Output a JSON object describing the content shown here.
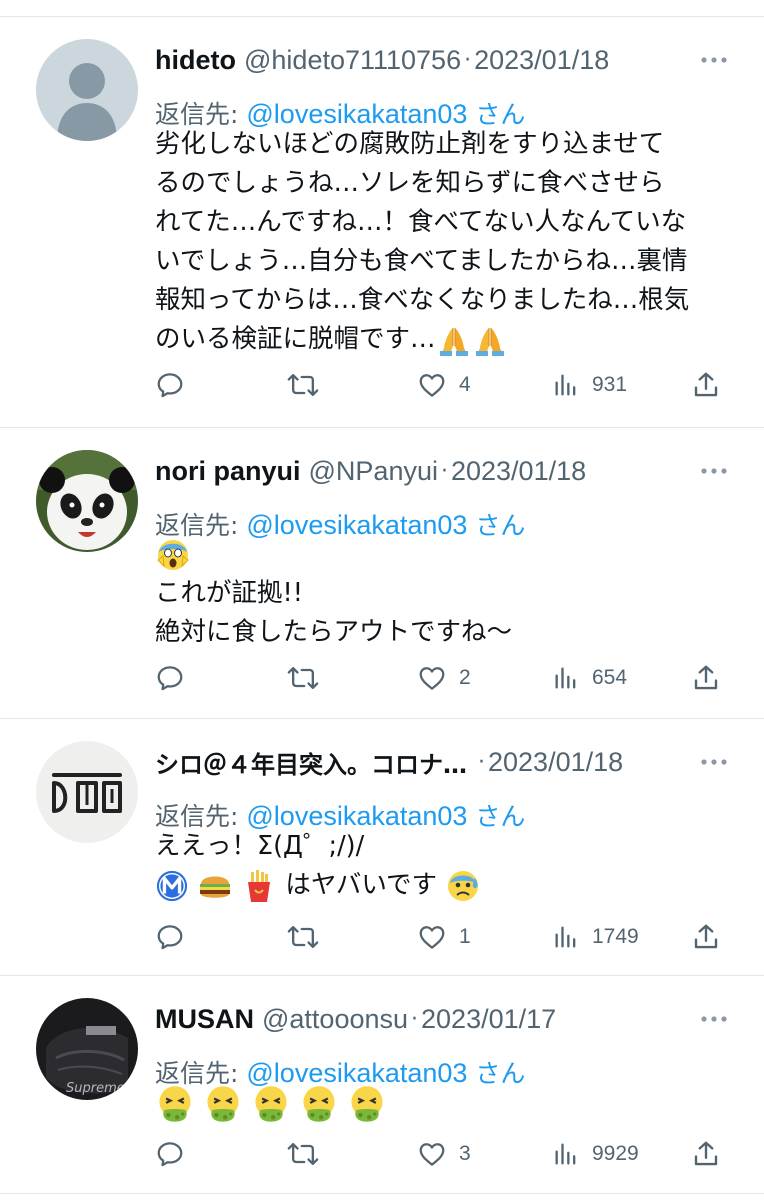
{
  "reply_prefix": "返信先:",
  "reply_suffix": "さん",
  "tweets": [
    {
      "name": "hideto",
      "handle": "@hideto71110756",
      "date": "2023/01/18",
      "reply_to": "@lovesikakatan03",
      "lines": [
        "劣化しないほどの腐敗防止剤をすり込ませて",
        "るのでしょうね…ソレを知らずに食べさせら",
        "れてた…んですね…！食べてない人なんていな",
        "いでしょう…自分も食べてましたからね…裏情",
        "報知ってからは…食べなくなりましたね…根気",
        "のいる検証に脱帽です…"
      ],
      "trailing_emoji": [
        "folded-hands",
        "folded-hands"
      ],
      "likes": "4",
      "views": "931",
      "avatar": "default-silhouette"
    },
    {
      "name": "nori panyui",
      "handle": "@NPanyui",
      "date": "2023/01/18",
      "reply_to": "@lovesikakatan03",
      "lead_emoji": "screaming-face",
      "lines": [
        "これが証拠!!",
        "絶対に食したらアウトですね〜"
      ],
      "likes": "2",
      "views": "654",
      "avatar": "panda"
    },
    {
      "name": "シロ＠４年目突入。コロナ…",
      "handle": "",
      "date": "2023/01/18",
      "reply_to": "@lovesikakatan03",
      "lines": [
        "ええっ！Σ(Д゜;/)/"
      ],
      "emoji_line_before": [
        "circled-m",
        "hamburger",
        "french-fries"
      ],
      "emoji_line_text": "はヤバいです",
      "emoji_line_after": [
        "anxious-face-with-sweat"
      ],
      "likes": "1",
      "views": "1749",
      "avatar": "handwritten-logo"
    },
    {
      "name": "MUSAN",
      "handle": "@attooonsu",
      "date": "2023/01/17",
      "reply_to": "@lovesikakatan03",
      "emoji_row": [
        "vomiting-face",
        "vomiting-face",
        "vomiting-face",
        "vomiting-face",
        "vomiting-face"
      ],
      "likes": "3",
      "views": "9929",
      "avatar": "dark-photo",
      "avatar_text": "Supreme"
    }
  ],
  "colors": {
    "text": "#0f1419",
    "muted": "#536471",
    "link": "#1d9bf0",
    "divider": "#e6e6e6"
  }
}
